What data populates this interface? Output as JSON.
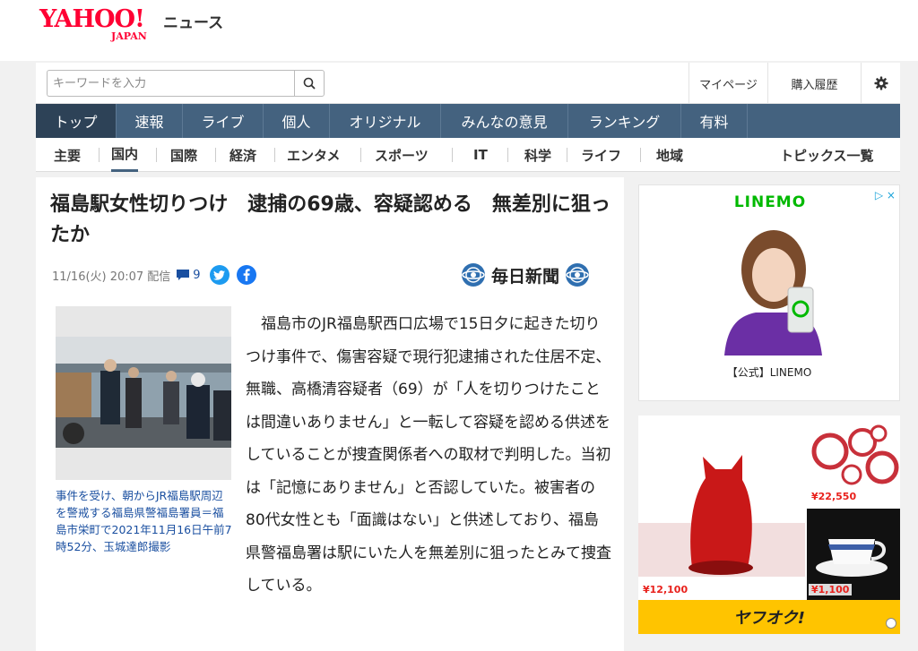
{
  "header": {
    "logo_main": "YAHOO!",
    "logo_sub": "JAPAN",
    "service_name": "ニュース",
    "search_placeholder": "キーワードを入力",
    "mypage": "マイページ",
    "purchase_history": "購入履歴"
  },
  "main_nav": [
    {
      "label": "トップ",
      "active": true
    },
    {
      "label": "速報"
    },
    {
      "label": "ライブ"
    },
    {
      "label": "個人"
    },
    {
      "label": "オリジナル"
    },
    {
      "label": "みんなの意見"
    },
    {
      "label": "ランキング"
    },
    {
      "label": "有料"
    }
  ],
  "sub_nav": [
    {
      "label": "主要"
    },
    {
      "label": "国内",
      "active": true
    },
    {
      "label": "国際"
    },
    {
      "label": "経済"
    },
    {
      "label": "エンタメ"
    },
    {
      "label": "スポーツ"
    },
    {
      "label": "IT"
    },
    {
      "label": "科学"
    },
    {
      "label": "ライフ"
    },
    {
      "label": "地域"
    }
  ],
  "topics_link": "トピックス一覧",
  "article": {
    "headline": "福島駅女性切りつけ　逮捕の69歳、容疑認める　無差別に狙ったか",
    "date": "11/16(火) 20:07",
    "haishin": "配信",
    "comment_count": "9",
    "publisher": "毎日新聞",
    "caption": "事件を受け、朝からJR福島駅周辺を警戒する福島県警福島署員＝福島市栄町で2021年11月16日午前7時52分、玉城達郎撮影",
    "body": "福島市のJR福島駅西口広場で15日夕に起きた切りつけ事件で、傷害容疑で現行犯逮捕された住居不定、無職、高橋清容疑者（69）が「人を切りつけたことは間違いありません」と一転して容疑を認める供述をしていることが捜査関係者への取材で判明した。当初は「記憶にありません」と否認していた。被害者の80代女性とも「面識はない」と供述しており、福島県警福島署は駅にいた人を無差別に狙ったとみて捜査している。"
  },
  "ads": {
    "linemo_brand": "LINEMO",
    "linemo_label": "【公式】LINEMO",
    "price_1": "¥22,550",
    "price_2": "¥12,100",
    "price_3": "¥1,100",
    "yafuoku": "ヤフオク!"
  },
  "colors": {
    "brand_red": "#ff0033",
    "nav_blue": "#44627f",
    "nav_active": "#2d4257",
    "link_blue": "#1a4fa0",
    "linemo_green": "#00b900",
    "yafuoku_yellow": "#ffc400"
  }
}
